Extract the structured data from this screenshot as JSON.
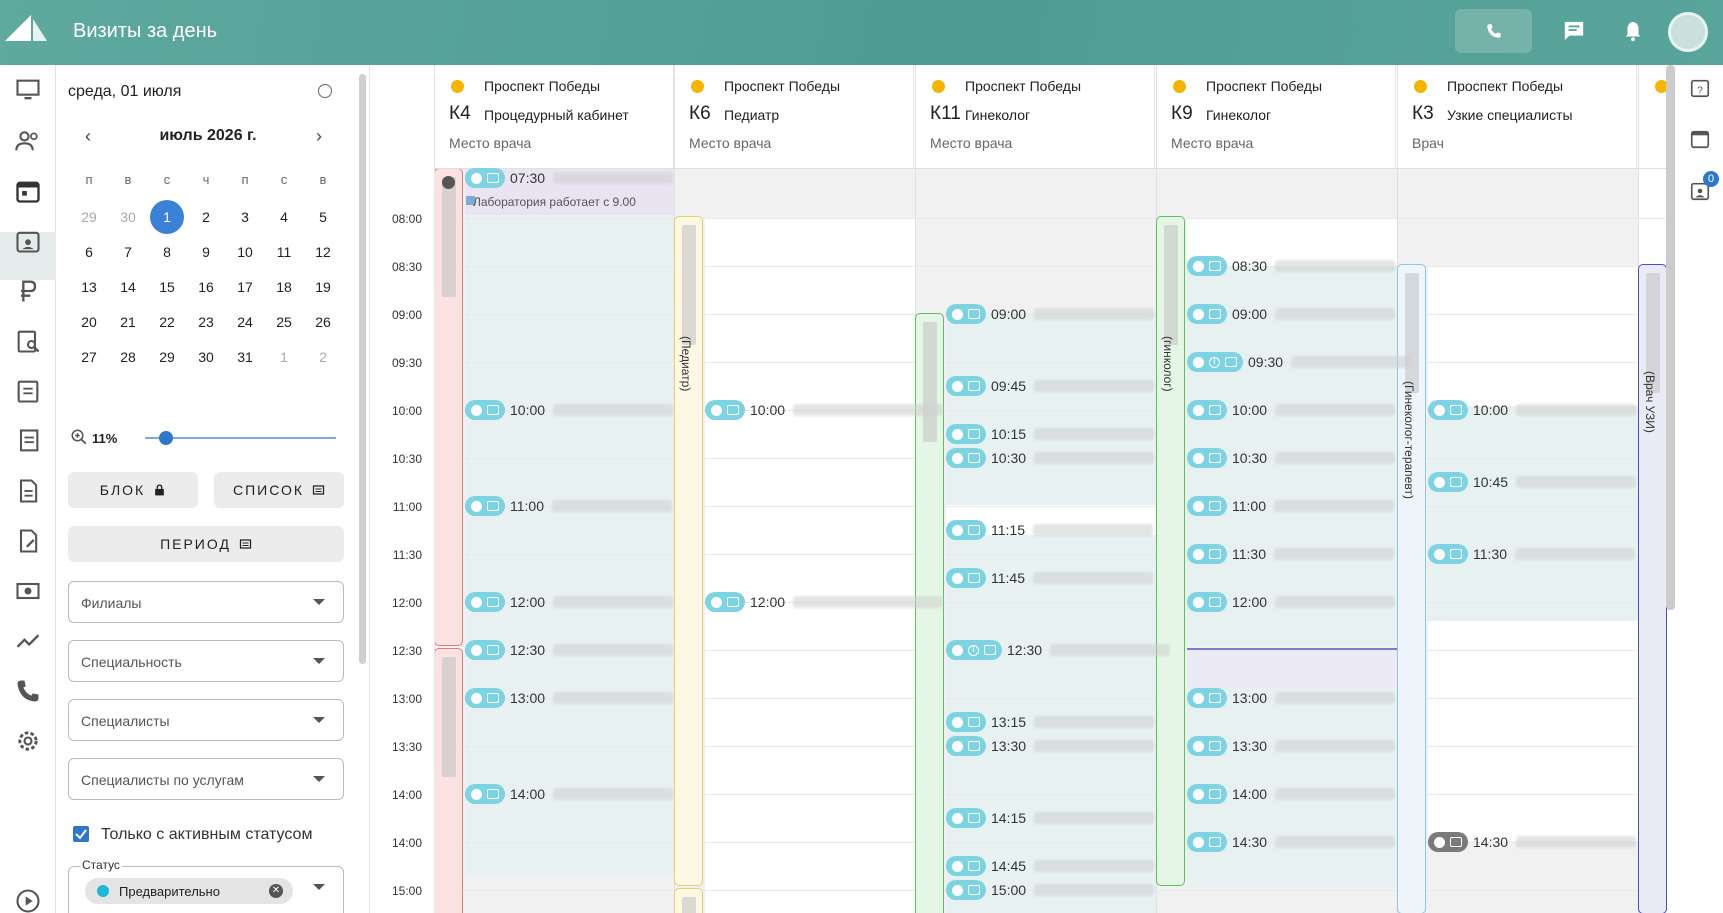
{
  "header": {
    "title": "Визиты за день"
  },
  "sidebar": {
    "current_date": "среда, 01 июля",
    "month_title": "июль 2026 г.",
    "weekdays": [
      "п",
      "в",
      "с",
      "ч",
      "п",
      "с",
      "в"
    ],
    "weeks": [
      [
        "29",
        "30",
        "1",
        "2",
        "3",
        "4",
        "5"
      ],
      [
        "6",
        "7",
        "8",
        "9",
        "10",
        "11",
        "12"
      ],
      [
        "13",
        "14",
        "15",
        "16",
        "17",
        "18",
        "19"
      ],
      [
        "20",
        "21",
        "22",
        "23",
        "24",
        "25",
        "26"
      ],
      [
        "27",
        "28",
        "29",
        "30",
        "31",
        "1",
        "2"
      ]
    ],
    "selected_day": "1",
    "zoom": "11%",
    "zoom_fraction": 0.11,
    "block_btn": "БЛОК",
    "list_btn": "СПИСОК",
    "period_btn": "ПЕРИОД",
    "filters": [
      "Филиалы",
      "Специальность",
      "Специалисты",
      "Специалисты по услугам"
    ],
    "active_only_label": "Только с активным статусом",
    "status_label": "Статус",
    "status_chip": "Предварительно"
  },
  "times": [
    "08:00",
    "08:30",
    "09:00",
    "09:30",
    "10:00",
    "10:30",
    "11:00",
    "11:30",
    "12:00",
    "12:30",
    "13:00",
    "13:30",
    "14:00",
    "14:00",
    "15:00"
  ],
  "columns": [
    {
      "branch": "Проспект Победы",
      "code": "К4",
      "spec": "Процедурный кабинет",
      "place": "Место врача"
    },
    {
      "branch": "Проспект Победы",
      "code": "К6",
      "spec": "Педиатр",
      "place": "Место врача"
    },
    {
      "branch": "Проспект Победы",
      "code": "К11",
      "spec": "Гинеколог",
      "place": "Место врача"
    },
    {
      "branch": "Проспект Победы",
      "code": "К9",
      "spec": "Гинеколог",
      "place": "Место врача"
    },
    {
      "branch": "Проспект Победы",
      "code": "К3",
      "spec": "Узкие специалисты",
      "place": "Врач"
    }
  ],
  "doctor_labels": [
    "(Педиатр)",
    "(гинколог)",
    "(Гинеколог-терапевт)",
    "(Врач УЗИ)"
  ],
  "lab_note": "Лаборатория работает с 9.00",
  "appointments": {
    "c1": [
      "07:30",
      "10:00",
      "11:00",
      "12:00",
      "12:30",
      "13:00",
      "14:00"
    ],
    "c2": [
      "10:00",
      "12:00"
    ],
    "c3": [
      "09:00",
      "09:45",
      "10:15",
      "10:30",
      "11:15",
      "11:45",
      "12:30",
      "13:15",
      "13:30",
      "14:15",
      "14:45",
      "15:00"
    ],
    "c4": [
      "08:30",
      "09:00",
      "09:30",
      "10:00",
      "10:30",
      "11:00",
      "11:30",
      "12:00",
      "13:00",
      "13:30",
      "14:00",
      "14:30"
    ],
    "c5": [
      "10:00",
      "10:45",
      "11:30",
      "14:30"
    ]
  },
  "right_badge": "0"
}
